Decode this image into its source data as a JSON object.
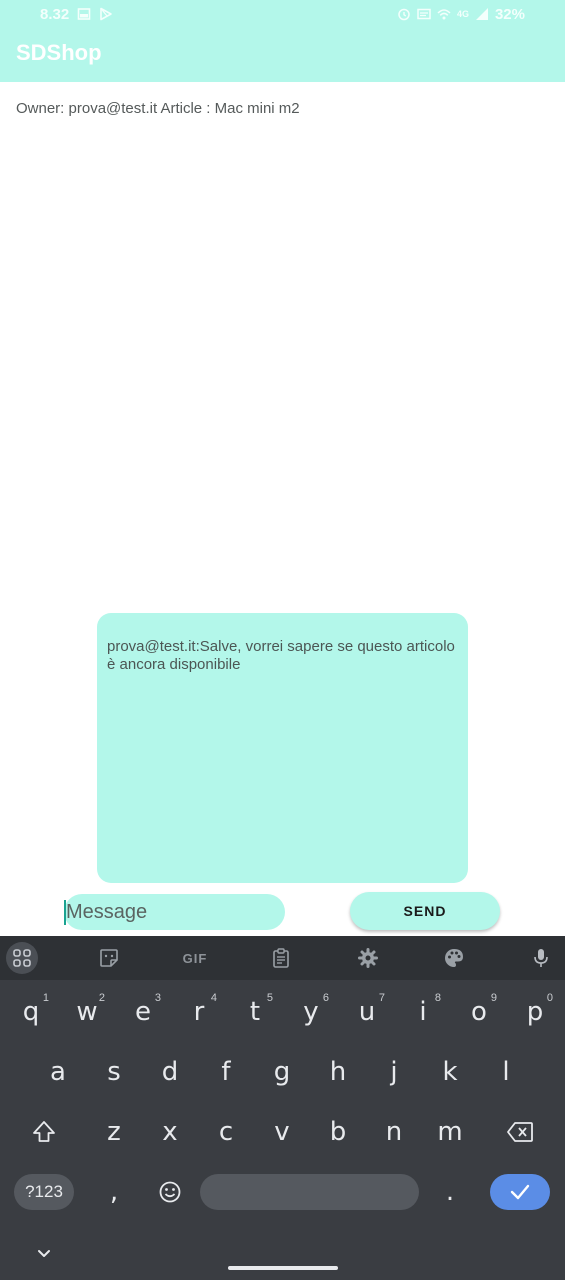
{
  "status_bar": {
    "time": "8.32",
    "battery_percent": "32%",
    "network_label": "4G",
    "left_icons": [
      "gallery-icon",
      "play-store-icon"
    ],
    "right_icons": [
      "alarm-icon",
      "cast-icon",
      "wifi-icon",
      "signal-icon"
    ]
  },
  "app_bar": {
    "title": "SDShop"
  },
  "header": {
    "owner_line": "Owner: prova@test.it Article : Mac mini m2"
  },
  "chat": {
    "messages": [
      {
        "text": "prova@test.it:Salve, vorrei sapere se questo articolo è ancora disponibile"
      }
    ]
  },
  "composer": {
    "input_placeholder": "Message",
    "input_value": "",
    "send_label": "SEND"
  },
  "keyboard": {
    "toolbar": [
      "apps-grid-icon",
      "sticker-icon",
      "gif-icon",
      "clipboard-icon",
      "settings-gear-icon",
      "palette-icon",
      "microphone-icon"
    ],
    "gif_label": "GIF",
    "row1": [
      {
        "key": "q",
        "hint": "1"
      },
      {
        "key": "w",
        "hint": "2"
      },
      {
        "key": "e",
        "hint": "3"
      },
      {
        "key": "r",
        "hint": "4"
      },
      {
        "key": "t",
        "hint": "5"
      },
      {
        "key": "y",
        "hint": "6"
      },
      {
        "key": "u",
        "hint": "7"
      },
      {
        "key": "i",
        "hint": "8"
      },
      {
        "key": "o",
        "hint": "9"
      },
      {
        "key": "p",
        "hint": "0"
      }
    ],
    "row2": [
      "a",
      "s",
      "d",
      "f",
      "g",
      "h",
      "j",
      "k",
      "l"
    ],
    "row3": [
      "z",
      "x",
      "c",
      "v",
      "b",
      "n",
      "m"
    ],
    "symbols_label": "?123",
    "comma_label": ",",
    "period_label": "."
  },
  "colors": {
    "accent": "#b3f7ea",
    "keyboard_bg": "#3a3d42",
    "enter_key": "#5b8de6"
  }
}
